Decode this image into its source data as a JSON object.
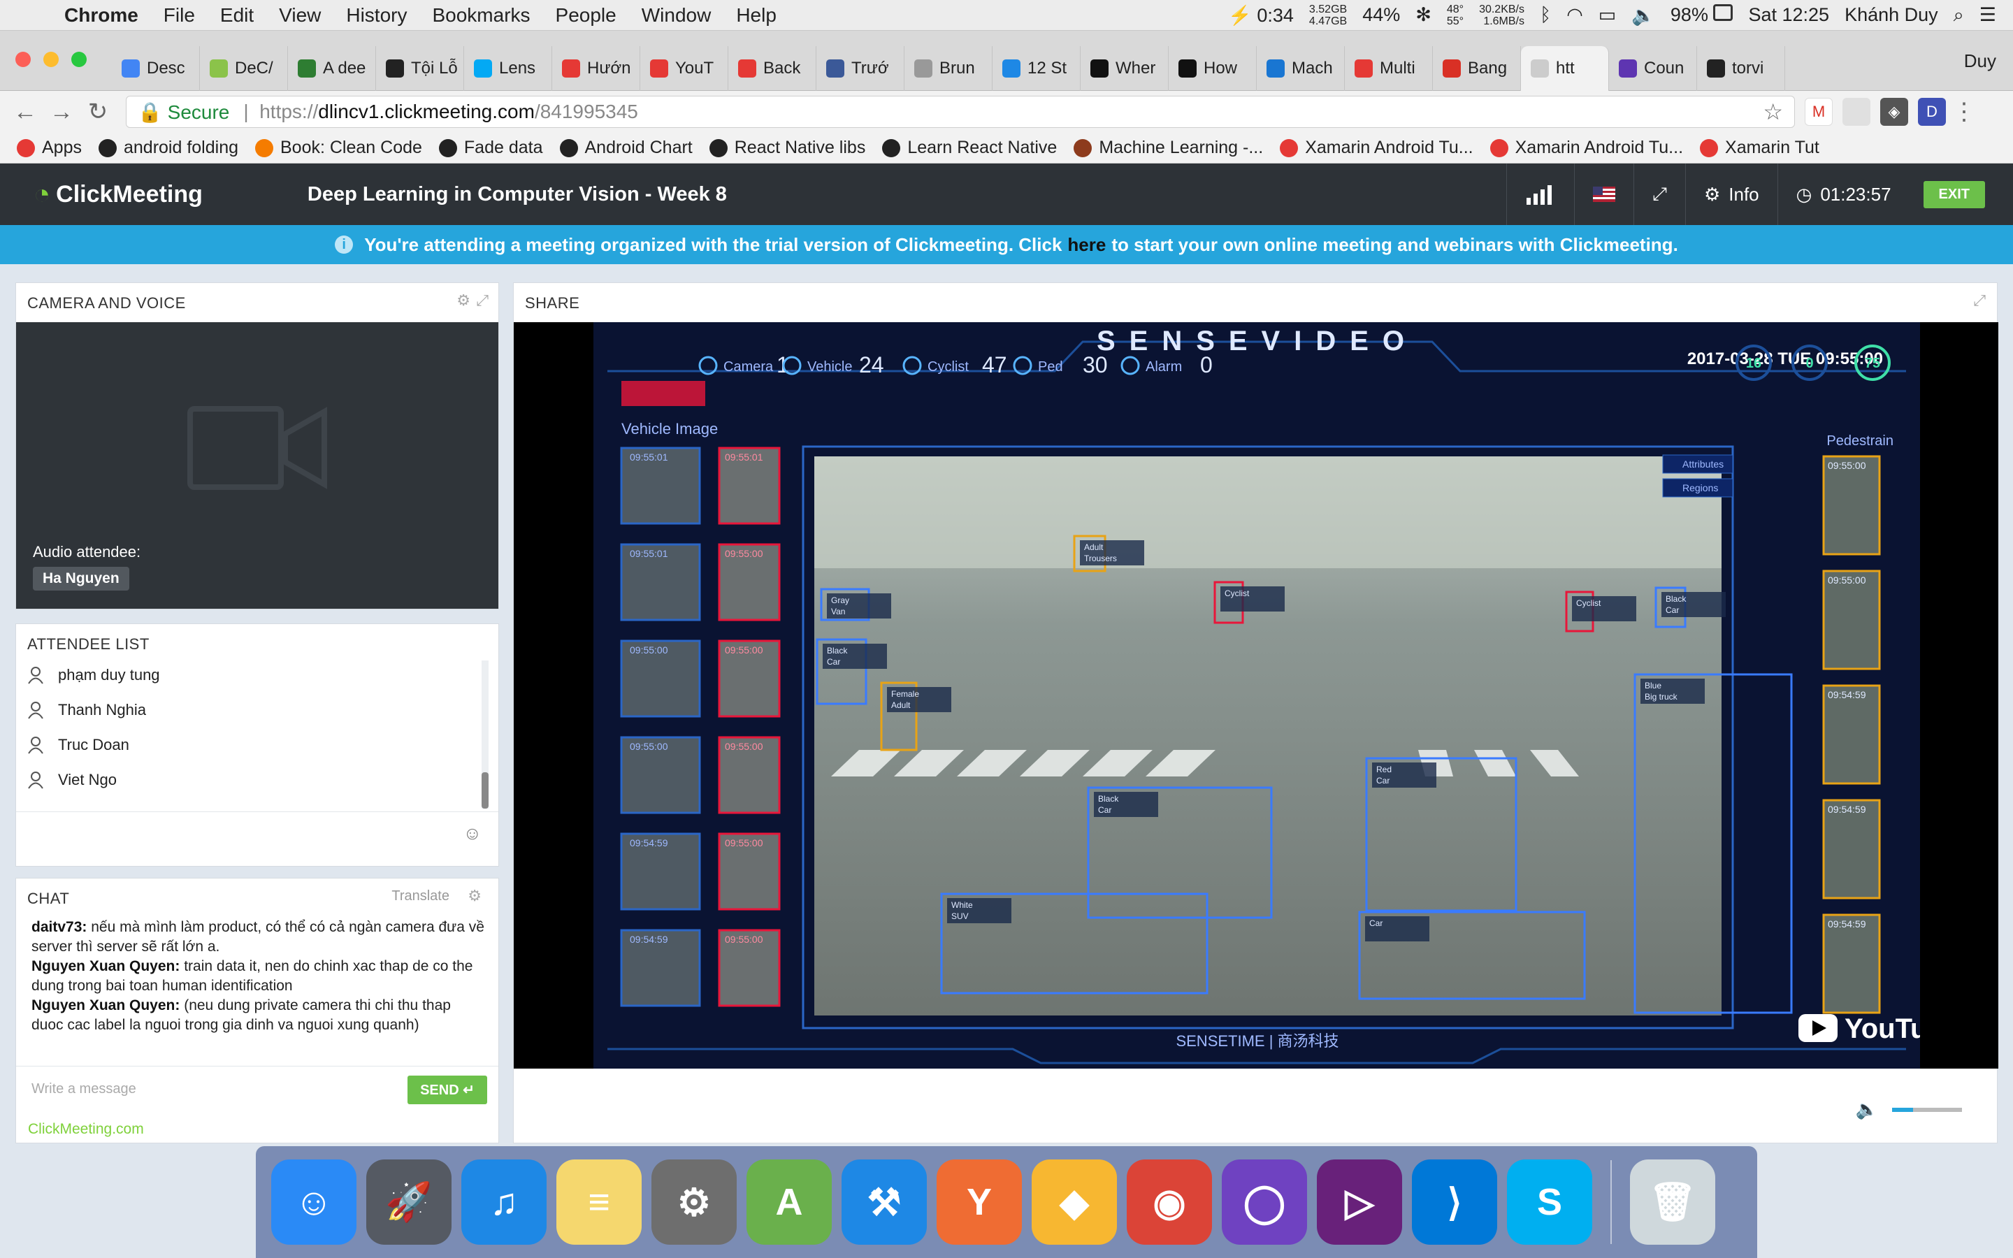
{
  "menubar": {
    "apple": "",
    "app": "Chrome",
    "items": [
      "File",
      "Edit",
      "View",
      "History",
      "Bookmarks",
      "People",
      "Window",
      "Help"
    ],
    "battery_time": "0:34",
    "mem_top": "3.52GB",
    "mem_bottom": "4.47GB",
    "cpu": "44%",
    "temp_top": "48°",
    "temp_bottom": "55°",
    "net_top": "30.2KB/s",
    "net_bottom": "1.6MB/s",
    "battery": "98%",
    "clock": "Sat 12:25",
    "user": "Khánh Duy"
  },
  "tabs": [
    {
      "label": "Desc",
      "color": "#4285f4"
    },
    {
      "label": "DeC/",
      "color": "#8bc34a"
    },
    {
      "label": "A dee",
      "color": "#2e7d32"
    },
    {
      "label": "Tội Lỗ",
      "color": "#222222"
    },
    {
      "label": "Lens",
      "color": "#03a9f4"
    },
    {
      "label": "Hướn",
      "color": "#e53935"
    },
    {
      "label": "YouT",
      "color": "#e53935"
    },
    {
      "label": "Back",
      "color": "#e53935"
    },
    {
      "label": "Trướ",
      "color": "#3b5998"
    },
    {
      "label": "Brun",
      "color": "#999999"
    },
    {
      "label": "12 St",
      "color": "#1e88e5"
    },
    {
      "label": "Wher",
      "color": "#111111"
    },
    {
      "label": "How",
      "color": "#111111"
    },
    {
      "label": "Mach",
      "color": "#1976d2"
    },
    {
      "label": "Multi",
      "color": "#e53935"
    },
    {
      "label": "Bang",
      "color": "#d93025"
    },
    {
      "label": "htt",
      "color": "#cccccc",
      "active": true
    },
    {
      "label": "Coun",
      "color": "#5e35b1"
    },
    {
      "label": "torvi",
      "color": "#222222"
    }
  ],
  "tab_user": "Duy",
  "address": {
    "secure_label": "Secure",
    "scheme": "https://",
    "host": "dlincv1.clickmeeting.com",
    "path": "/841995345"
  },
  "bookmarks": [
    {
      "label": "Apps",
      "color": "#e53935"
    },
    {
      "label": "android folding",
      "color": "#222222"
    },
    {
      "label": "Book: Clean Code",
      "color": "#f57c00"
    },
    {
      "label": "Fade data",
      "color": "#222222"
    },
    {
      "label": "Android Chart",
      "color": "#222222"
    },
    {
      "label": "React Native libs",
      "color": "#222222"
    },
    {
      "label": "Learn React Native",
      "color": "#222222"
    },
    {
      "label": "Machine Learning -...",
      "color": "#8d3b1d"
    },
    {
      "label": "Xamarin Android Tu...",
      "color": "#e53935"
    },
    {
      "label": "Xamarin Android Tu...",
      "color": "#e53935"
    },
    {
      "label": "Xamarin Tut",
      "color": "#e53935"
    }
  ],
  "cm": {
    "logo": "ClickMeeting",
    "title": "Deep Learning in Computer Vision - Week 8",
    "info_label": "Info",
    "timer": "01:23:57",
    "exit_label": "EXIT",
    "banner_pre": "You're attending a meeting organized with the trial version of Clickmeeting. Click",
    "banner_link": "here",
    "banner_post": "to start your own online meeting and webinars with Clickmeeting."
  },
  "camera": {
    "title": "CAMERA AND VOICE",
    "audio_label": "Audio attendee:",
    "audio_name": "Ha Nguyen"
  },
  "attendees": {
    "title": "ATTENDEE LIST",
    "names": [
      "phạm duy tung",
      "Thanh Nghia",
      "Truc Doan",
      "Viet Ngo"
    ]
  },
  "chat": {
    "title": "CHAT",
    "translate_label": "Translate",
    "messages": [
      {
        "author": "daitv73:",
        "text": "nếu mà mình làm product, có thể có cả ngàn camera đưa về server thì server sẽ rất lớn a."
      },
      {
        "author": "Nguyen Xuan Quyen:",
        "text": "train data it, nen do chinh xac thap de co the dung trong bai toan human identification"
      },
      {
        "author": "Nguyen Xuan Quyen:",
        "text": "(neu dung private camera thi chi thu thap duoc cac label la nguoi trong gia dinh va nguoi xung quanh)"
      }
    ],
    "placeholder": "Write a message",
    "send_label": "SEND",
    "powered": "ClickMeeting.com"
  },
  "share": {
    "title": "SHARE",
    "brand": "SENSEVIDEO",
    "datetime": "2017-03-28  TUE  09:55:00",
    "stats": [
      {
        "label": "Camera",
        "value": "1"
      },
      {
        "label": "Vehicle",
        "value": "24"
      },
      {
        "label": "Cyclist",
        "value": "47"
      },
      {
        "label": "Ped",
        "value": "30"
      },
      {
        "label": "Alarm",
        "value": "0"
      }
    ],
    "gauges": [
      "16",
      "0",
      "75"
    ],
    "left_header": "Vehicle Image",
    "right_header": "Pedestrain",
    "left_times": [
      "09:55:01",
      "09:55:01",
      "09:55:00",
      "09:55:00",
      "09:54:59",
      "09:54:59"
    ],
    "left_times_red": [
      "09:55:01",
      "09:55:00",
      "09:55:00",
      "09:55:00",
      "09:55:00",
      "09:55:00"
    ],
    "right_times": [
      "09:55:00",
      "09:55:00",
      "09:54:59",
      "09:54:59",
      "09:54:59"
    ],
    "toggles": [
      "Attributes",
      "Regions"
    ],
    "footer_brand": "SENSETIME | 商汤科技",
    "youtube": "YouTube",
    "volume_level": 0.3,
    "boxes": [
      {
        "label": "Black",
        "sub": "Car"
      },
      {
        "label": "Red",
        "sub": "Car"
      },
      {
        "label": "White",
        "sub": "SUV"
      },
      {
        "label": "Car",
        "sub": ""
      },
      {
        "label": "Blue",
        "sub": "Big truck"
      },
      {
        "label": "Female",
        "sub": "Adult"
      },
      {
        "label": "Gray",
        "sub": "Van"
      },
      {
        "label": "Black",
        "sub": "Car"
      },
      {
        "label": "Cyclist",
        "sub": ""
      },
      {
        "label": "Adult",
        "sub": "Trousers"
      },
      {
        "label": "Cyclist",
        "sub": ""
      },
      {
        "label": "Black",
        "sub": "Car"
      }
    ]
  },
  "dock": [
    {
      "name": "finder",
      "color": "#2a8af6",
      "glyph": "☺"
    },
    {
      "name": "launchpad",
      "color": "#555a63",
      "glyph": "🚀"
    },
    {
      "name": "itunes",
      "color": "#1e88e5",
      "glyph": "♫"
    },
    {
      "name": "notes",
      "color": "#f5d76e",
      "glyph": "≡"
    },
    {
      "name": "system-preferences",
      "color": "#6e6e6e",
      "glyph": "⚙"
    },
    {
      "name": "android-studio",
      "color": "#6ab04c",
      "glyph": "A"
    },
    {
      "name": "xcode",
      "color": "#1e88e5",
      "glyph": "⚒"
    },
    {
      "name": "postman",
      "color": "#ef6c33",
      "glyph": "Y"
    },
    {
      "name": "sketch",
      "color": "#f7b731",
      "glyph": "◆"
    },
    {
      "name": "chrome",
      "color": "#db4437",
      "glyph": "◉"
    },
    {
      "name": "github-desktop",
      "color": "#6f42c1",
      "glyph": "◯"
    },
    {
      "name": "visual-studio",
      "color": "#68217a",
      "glyph": "▷"
    },
    {
      "name": "vscode",
      "color": "#0078d7",
      "glyph": "⟩"
    },
    {
      "name": "skype",
      "color": "#00aff0",
      "glyph": "S"
    },
    {
      "name": "trash",
      "color": "#cfd8dc",
      "glyph": "🗑"
    }
  ]
}
